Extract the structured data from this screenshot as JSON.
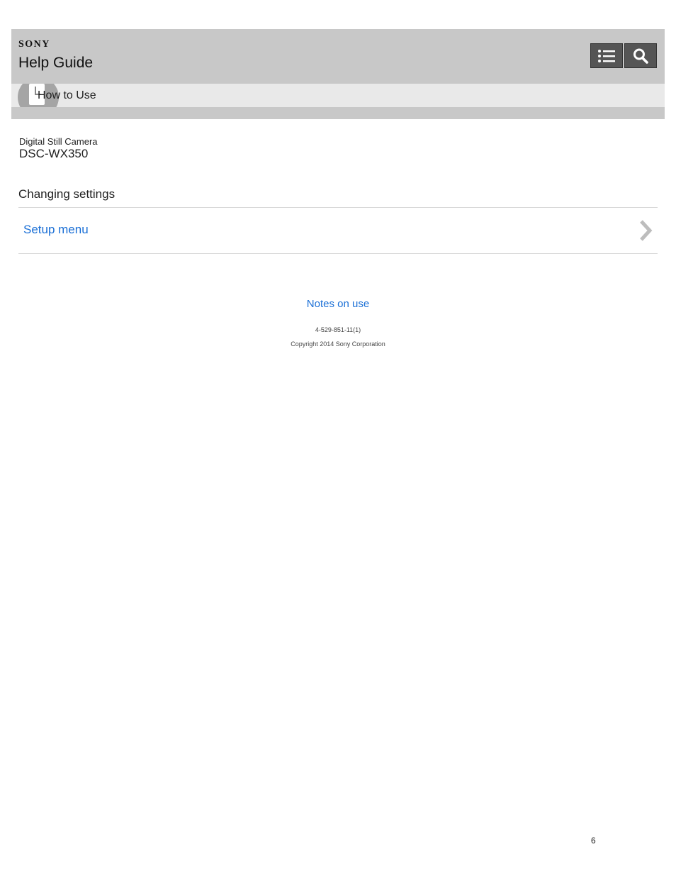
{
  "header": {
    "brand": "SONY",
    "title": "Help Guide",
    "toc_icon": "list-icon",
    "search_icon": "search-icon"
  },
  "subbar": {
    "label": "How to Use",
    "icon": "document-icon"
  },
  "product": {
    "type": "Digital Still Camera",
    "model": "DSC-WX350"
  },
  "section": {
    "title": "Changing settings",
    "items": [
      {
        "label": "Setup menu",
        "icon": "chevron-right-icon"
      }
    ]
  },
  "footer": {
    "notes_link": "Notes on use",
    "doc_id": "4-529-851-11(1)",
    "copyright": "Copyright 2014 Sony Corporation"
  },
  "page_number": "6",
  "colors": {
    "header_bg": "#c8c8c8",
    "subbar_bg": "#e9e9e9",
    "link": "#1a6fd6",
    "button_bg": "#555555"
  }
}
